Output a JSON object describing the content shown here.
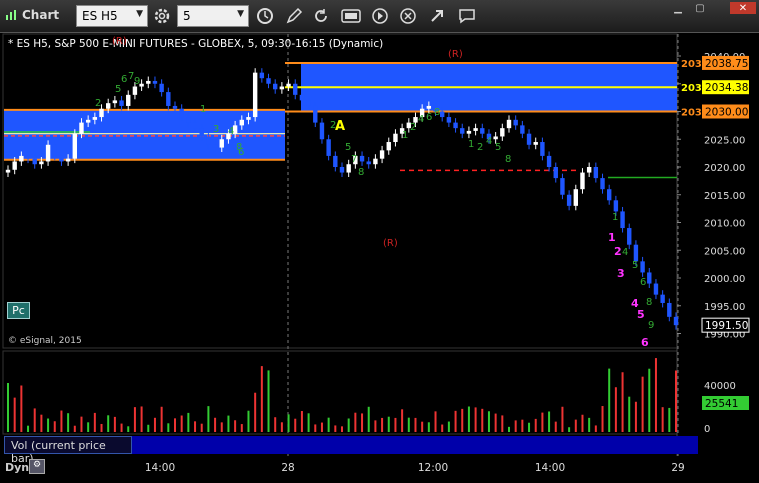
{
  "window": {
    "title": "Chart"
  },
  "toolbar": {
    "symbol_value": "ES H5",
    "interval_value": "5",
    "icons": [
      "gear-icon",
      "clock-icon",
      "pencil-icon",
      "refresh-icon",
      "study-icon",
      "play-icon",
      "x-icon",
      "link-icon",
      "comment-icon"
    ]
  },
  "chart": {
    "header": "* ES H5, S&P 500 E-MINI FUTURES - GLOBEX, 5, 09:30-16:15 (Dynamic)",
    "copyright": "© eSignal, 2015",
    "pc_button": "Pc",
    "price_ticks": [
      "2040.00",
      "2035.00",
      "2030.00",
      "2025.00",
      "2020.00",
      "2015.00",
      "2010.00",
      "2005.00",
      "2000.00",
      "1995.00",
      "1990.00"
    ],
    "price_labels": [
      {
        "value": "2038.75",
        "color": "#ff8c1a",
        "text": "203"
      },
      {
        "value": "2034.38",
        "color": "#ffff00",
        "text": "203"
      },
      {
        "value": "2030.00",
        "color": "#ff8c1a",
        "text": "203"
      },
      {
        "value": "1991.50",
        "color": "#ffffff",
        "text": ""
      }
    ],
    "markers": [
      "(R)",
      "(R)",
      "(R)",
      "A"
    ],
    "count_labels": [
      "1",
      "2",
      "3",
      "4",
      "5",
      "6"
    ]
  },
  "volume": {
    "label": "Vol (current price bar)",
    "ticks": [
      "40000",
      "20000",
      "0"
    ],
    "current": "25541"
  },
  "time_axis": {
    "labels": [
      "14:00",
      "28",
      "12:00",
      "14:00",
      "29"
    ]
  },
  "footer": {
    "dyn": "Dyn"
  },
  "colors": {
    "box": "#1f56ff",
    "orange": "#ff8c1a",
    "yellow": "#ffff00",
    "green": "#2e8b2e",
    "magenta": "#ff33ff",
    "red": "#ff3333"
  }
}
